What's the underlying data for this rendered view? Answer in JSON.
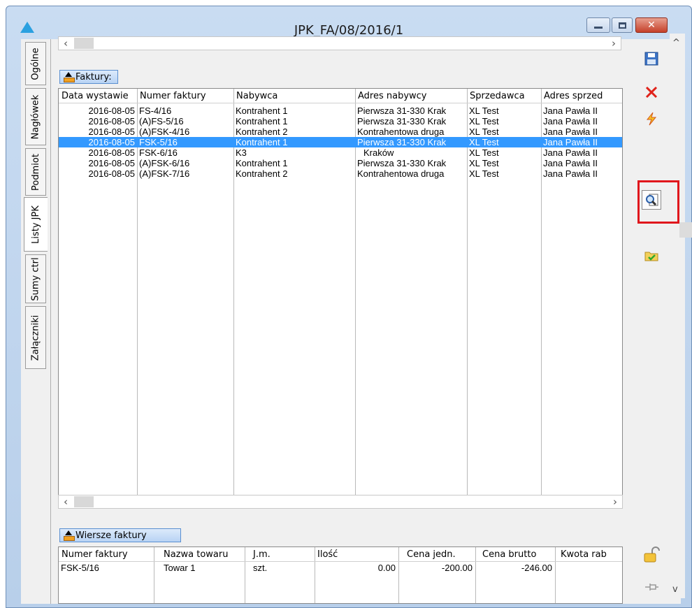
{
  "window": {
    "title": "JPK_FA/08/2016/1"
  },
  "tabs": [
    {
      "label": "Ogólne",
      "active": false
    },
    {
      "label": "Nagłówek",
      "active": false
    },
    {
      "label": "Podmiot",
      "active": false
    },
    {
      "label": "Listy JPK",
      "active": true
    },
    {
      "label": "Sumy ctrl",
      "active": false
    },
    {
      "label": "Załączniki",
      "active": false
    }
  ],
  "faktury": {
    "label": "Faktury:",
    "columns": [
      "Data wystawie",
      "Numer faktury",
      "Nabywca",
      "Adres nabywcy",
      "Sprzedawca",
      "Adres sprzed"
    ],
    "rows": [
      [
        "2016-08-05",
        "FS-4/16",
        "Kontrahent 1",
        "Pierwsza 31-330 Krak",
        "XL Test",
        "Jana Pawła II"
      ],
      [
        "2016-08-05",
        "(A)FS-5/16",
        "Kontrahent 1",
        "Pierwsza 31-330 Krak",
        "XL Test",
        "Jana Pawła II"
      ],
      [
        "2016-08-05",
        "(A)FSK-4/16",
        "Kontrahent 2",
        "Kontrahentowa druga",
        "XL Test",
        "Jana Pawła II"
      ],
      [
        "2016-08-05",
        "FSK-5/16",
        "Kontrahent 1",
        "Pierwsza 31-330 Krak",
        "XL Test",
        "Jana Pawła II"
      ],
      [
        "2016-08-05",
        "FSK-6/16",
        "K3",
        "Kraków",
        "XL Test",
        "Jana Pawła II"
      ],
      [
        "2016-08-05",
        "(A)FSK-6/16",
        "Kontrahent 1",
        "Pierwsza 31-330 Krak",
        "XL Test",
        "Jana Pawła II"
      ],
      [
        "2016-08-05",
        "(A)FSK-7/16",
        "Kontrahent 2",
        "Kontrahentowa druga",
        "XL Test",
        "Jana Pawła II"
      ]
    ],
    "selected_row": 3
  },
  "wiersze": {
    "label": "Wiersze faktury",
    "columns": [
      "Numer faktury",
      "Nazwa towaru",
      "J.m.",
      "Ilość",
      "Cena jedn.",
      "Cena brutto",
      "Kwota rab"
    ],
    "rows": [
      [
        "FSK-5/16",
        "Towar 1",
        "szt.",
        "0.00",
        "-200.00",
        "-246.00",
        ""
      ]
    ]
  },
  "toolbar": {
    "icons": [
      "save-icon",
      "delete-icon",
      "generate-icon",
      "preview-icon",
      "approve-icon",
      "lock-icon",
      "pin-icon"
    ]
  },
  "colors": {
    "selection": "#3399ff",
    "highlight_frame": "#e0161c"
  }
}
